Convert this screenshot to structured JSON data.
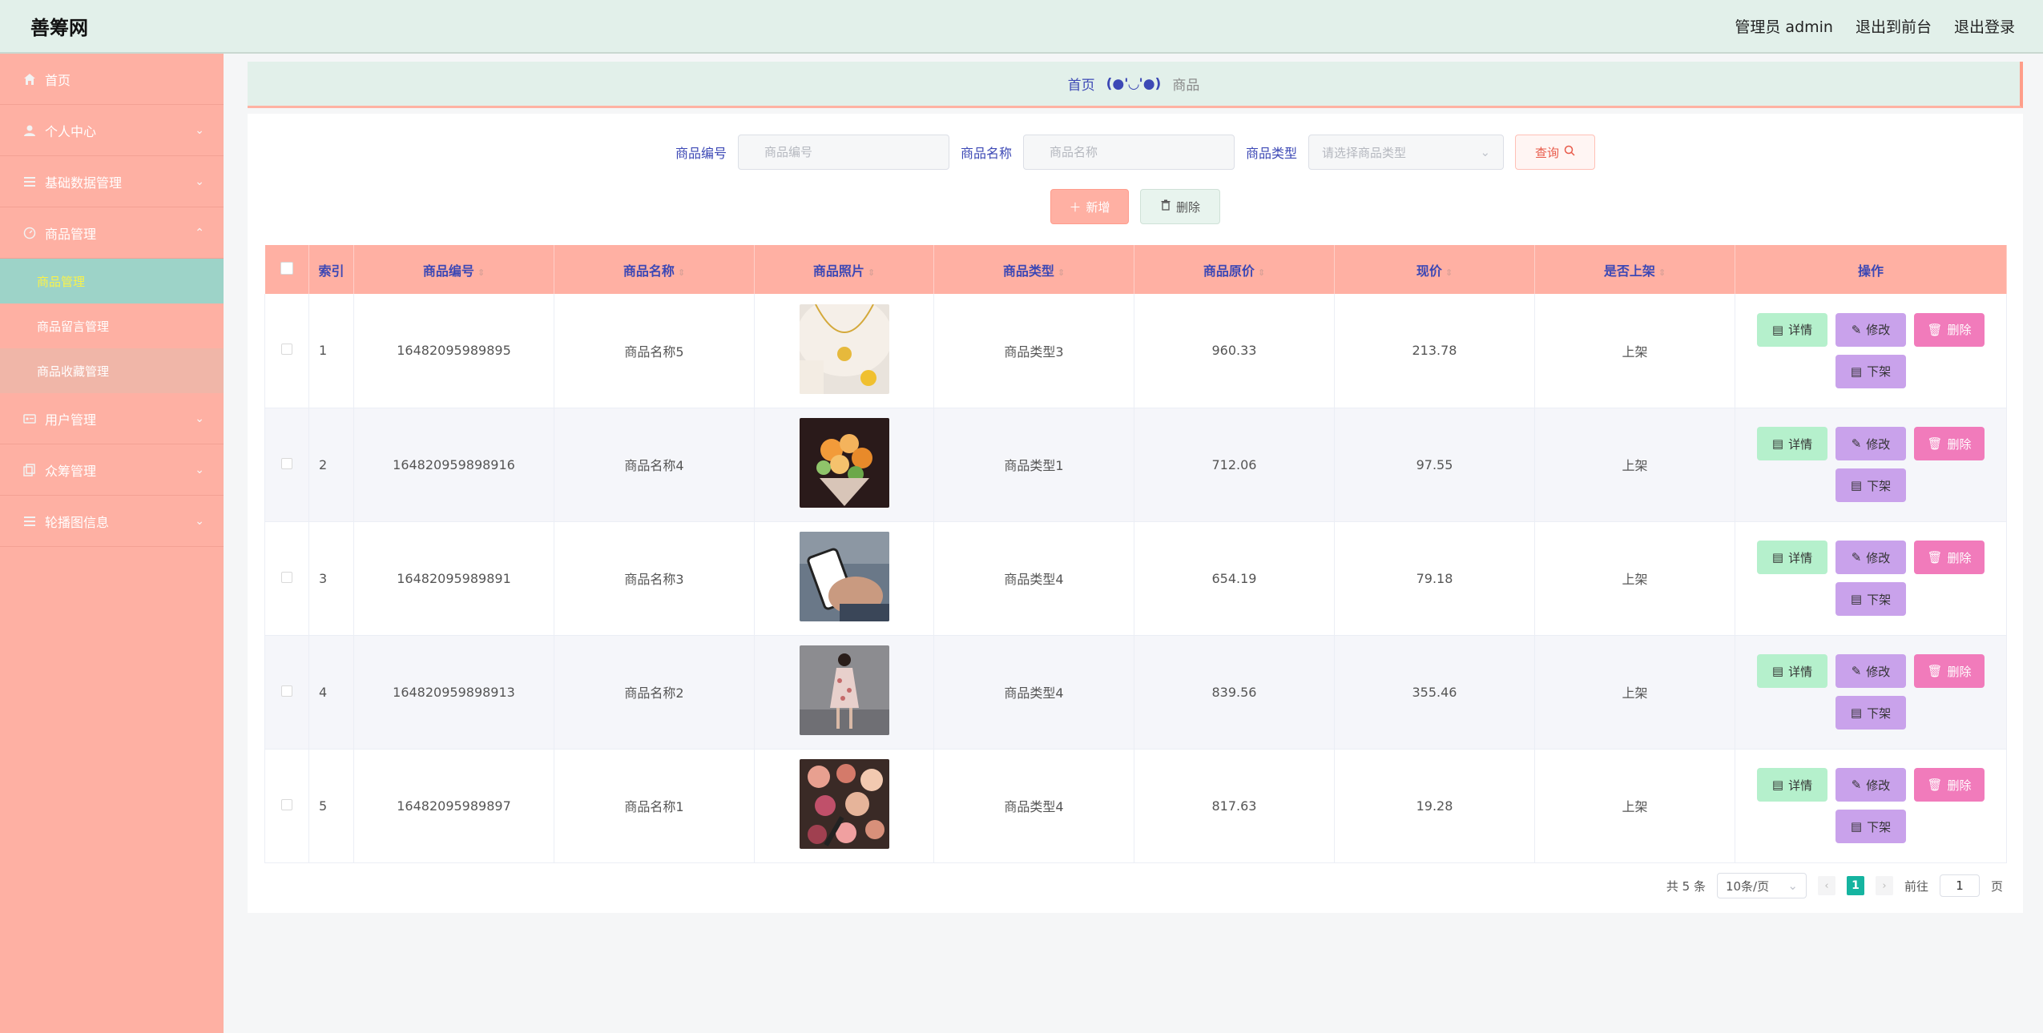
{
  "header": {
    "brand": "善筹网",
    "admin": "管理员 admin",
    "to_front": "退出到前台",
    "logout": "退出登录"
  },
  "sidebar": {
    "items": [
      {
        "label": "首页",
        "icon": "home-icon"
      },
      {
        "label": "个人中心",
        "icon": "user-icon"
      },
      {
        "label": "基础数据管理",
        "icon": "list-icon"
      },
      {
        "label": "商品管理",
        "icon": "gauge-icon"
      },
      {
        "label": "用户管理",
        "icon": "id-card-icon"
      },
      {
        "label": "众筹管理",
        "icon": "copy-icon"
      },
      {
        "label": "轮播图信息",
        "icon": "list-icon"
      }
    ],
    "sub": [
      "商品管理",
      "商品留言管理",
      "商品收藏管理"
    ]
  },
  "breadcrumb": {
    "home": "首页",
    "kaomoji": "(●'◡'●)",
    "current": "商品"
  },
  "search": {
    "code_label": "商品编号",
    "code_placeholder": "商品编号",
    "name_label": "商品名称",
    "name_placeholder": "商品名称",
    "type_label": "商品类型",
    "type_placeholder": "请选择商品类型",
    "query": "查询"
  },
  "actions": {
    "add": "新增",
    "delete": "删除"
  },
  "table": {
    "headers": [
      "索引",
      "商品编号",
      "商品名称",
      "商品照片",
      "商品类型",
      "商品原价",
      "现价",
      "是否上架",
      "操作"
    ],
    "rows": [
      {
        "index": "1",
        "code": "16482095989895",
        "name": "商品名称5",
        "photo": "necklace",
        "type": "商品类型3",
        "orig": "960.33",
        "price": "213.78",
        "status": "上架"
      },
      {
        "index": "2",
        "code": "164820959898916",
        "name": "商品名称4",
        "photo": "flowers",
        "type": "商品类型1",
        "orig": "712.06",
        "price": "97.55",
        "status": "上架"
      },
      {
        "index": "3",
        "code": "16482095989891",
        "name": "商品名称3",
        "photo": "phone",
        "type": "商品类型4",
        "orig": "654.19",
        "price": "79.18",
        "status": "上架"
      },
      {
        "index": "4",
        "code": "164820959898913",
        "name": "商品名称2",
        "photo": "dress",
        "type": "商品类型4",
        "orig": "839.56",
        "price": "355.46",
        "status": "上架"
      },
      {
        "index": "5",
        "code": "16482095989897",
        "name": "商品名称1",
        "photo": "makeup",
        "type": "商品类型4",
        "orig": "817.63",
        "price": "19.28",
        "status": "上架"
      }
    ],
    "btn_detail": "详情",
    "btn_edit": "修改",
    "btn_remove": "删除",
    "btn_down": "下架"
  },
  "pagination": {
    "total": "共 5 条",
    "page_size": "10条/页",
    "current": "1",
    "goto": "前往",
    "goto_value": "1",
    "page_unit": "页"
  },
  "colors": {
    "sidebar": "#feb0a3",
    "header": "#e2f0ea",
    "active": "#9dd3c8",
    "accent_text": "#3c48b5"
  }
}
